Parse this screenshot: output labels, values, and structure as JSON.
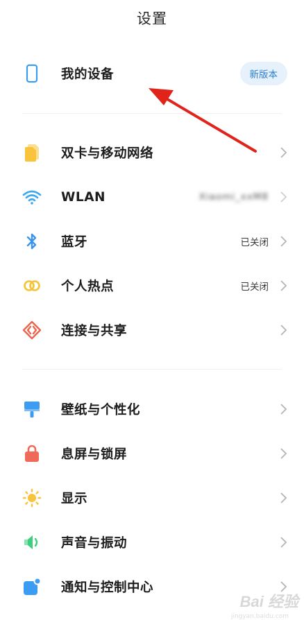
{
  "header": {
    "title": "设置"
  },
  "device": {
    "label": "我的设备",
    "badge": "新版本"
  },
  "network": [
    {
      "label": "双卡与移动网络",
      "value": ""
    },
    {
      "label": "WLAN",
      "value": "Xiaomi_xxM8"
    },
    {
      "label": "蓝牙",
      "value": "已关闭"
    },
    {
      "label": "个人热点",
      "value": "已关闭"
    },
    {
      "label": "连接与共享",
      "value": ""
    }
  ],
  "personal": [
    {
      "label": "壁纸与个性化"
    },
    {
      "label": "息屏与锁屏"
    },
    {
      "label": "显示"
    },
    {
      "label": "声音与振动"
    },
    {
      "label": "通知与控制中心"
    }
  ],
  "icons": {
    "device": "phone-outline-icon",
    "sim": "sim-cards-icon",
    "wlan": "wifi-icon",
    "bluetooth": "bluetooth-icon",
    "hotspot": "hotspot-rings-icon",
    "share": "share-diamond-icon",
    "wallpaper": "paint-roller-icon",
    "lock": "lock-icon",
    "display": "sun-icon",
    "sound": "speaker-icon",
    "notify": "notification-square-icon"
  },
  "colors": {
    "sim": "#f9c33b",
    "wlan": "#3ba8f0",
    "bluetooth": "#3a93f0",
    "hotspot": "#f6c333",
    "share": "#f0634d",
    "wallpaper": "#3c9cf3",
    "lock": "#f06a5a",
    "display": "#f9c33b",
    "sound": "#3fce7b",
    "notify": "#3b9cf1",
    "badge_text": "#2c7fd1",
    "annotation_arrow": "#e0241b"
  },
  "watermark": {
    "text": "Bai 经验",
    "sub": "jingyan.baidu.com"
  }
}
